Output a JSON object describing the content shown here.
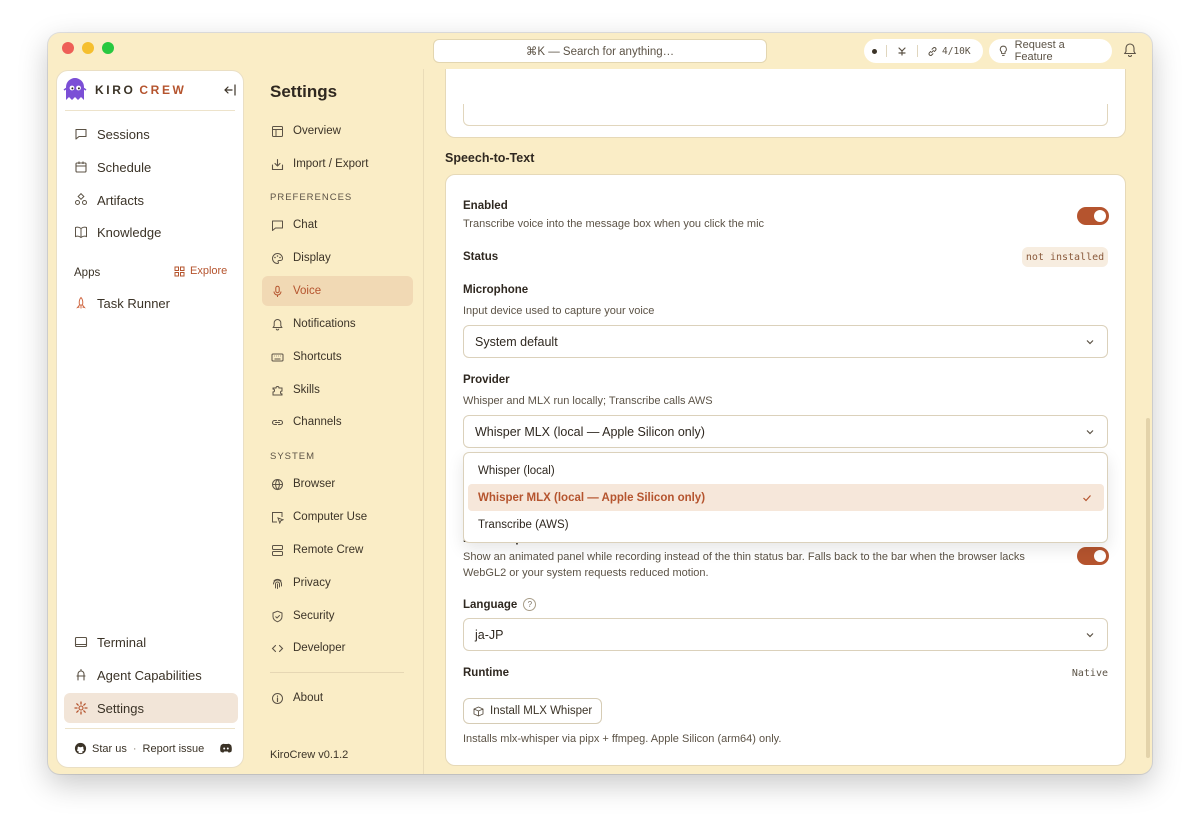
{
  "topbar": {
    "search_placeholder": "⌘K — Search for anything…",
    "token_usage": "4/10K",
    "request_feature_label": "Request a Feature"
  },
  "brand": {
    "name_a": "KIRO",
    "name_b": "CREW"
  },
  "sidebar": {
    "items": [
      {
        "label": "Sessions"
      },
      {
        "label": "Schedule"
      },
      {
        "label": "Artifacts"
      },
      {
        "label": "Knowledge"
      }
    ],
    "apps_label": "Apps",
    "explore_label": "Explore",
    "apps": [
      {
        "label": "Task Runner"
      }
    ],
    "bottom_items": [
      {
        "label": "Terminal"
      },
      {
        "label": "Agent Capabilities"
      },
      {
        "label": "Settings"
      }
    ],
    "footer": {
      "star": "Star us",
      "report": "Report issue"
    }
  },
  "settings_nav": {
    "title": "Settings",
    "items": [
      {
        "label": "Overview"
      },
      {
        "label": "Import / Export"
      }
    ],
    "preferences_header": "PREFERENCES",
    "preferences": [
      {
        "label": "Chat"
      },
      {
        "label": "Display"
      },
      {
        "label": "Voice"
      },
      {
        "label": "Notifications"
      },
      {
        "label": "Shortcuts"
      },
      {
        "label": "Skills"
      },
      {
        "label": "Channels"
      }
    ],
    "system_header": "SYSTEM",
    "system": [
      {
        "label": "Browser"
      },
      {
        "label": "Computer Use"
      },
      {
        "label": "Remote Crew"
      },
      {
        "label": "Privacy"
      },
      {
        "label": "Security"
      },
      {
        "label": "Developer"
      }
    ],
    "about": "About",
    "version": "KiroCrew v0.1.2"
  },
  "voice": {
    "section_title": "Speech-to-Text",
    "enabled": {
      "label": "Enabled",
      "desc": "Transcribe voice into the message box when you click the mic",
      "on": true
    },
    "status": {
      "label": "Status",
      "value": "not installed"
    },
    "microphone": {
      "label": "Microphone",
      "desc": "Input device used to capture your voice",
      "value": "System default"
    },
    "provider": {
      "label": "Provider",
      "desc": "Whisper and MLX run locally; Transcribe calls AWS",
      "value": "Whisper MLX (local — Apple Silicon only)",
      "options": [
        "Whisper (local)",
        "Whisper MLX (local — Apple Silicon only)",
        "Transcribe (AWS)"
      ],
      "selected_index": 1
    },
    "dictation": {
      "label": "Dictation panel",
      "desc_line1": "Show an animated panel while recording instead of the thin status bar. Falls back to the bar when the browser lacks",
      "desc_line2": "WebGL2 or your system requests reduced motion.",
      "on": true
    },
    "language": {
      "label": "Language",
      "help": "?",
      "value": "ja-JP"
    },
    "runtime": {
      "label": "Runtime",
      "value": "Native",
      "install_label": "Install MLX Whisper",
      "note": "Installs mlx-whisper via pipx + ffmpeg. Apple Silicon (arm64) only."
    }
  },
  "colors": {
    "accent": "#b5542e",
    "window_bg": "#faedc6",
    "active_nav": "#f1d9b4"
  }
}
